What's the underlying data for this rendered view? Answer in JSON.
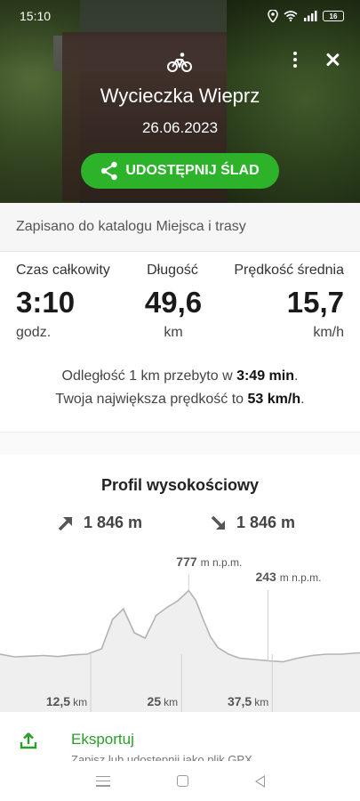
{
  "status_bar": {
    "time": "15:10",
    "battery": "16"
  },
  "header": {
    "title": "Wycieczka Wieprz",
    "date": "26.06.2023",
    "share_label": "UDOSTĘPNIJ ŚLAD"
  },
  "saved_notice": "Zapisano do katalogu Miejsca i trasy",
  "stats": [
    {
      "label": "Czas całkowity",
      "value": "3:10",
      "unit": "godz."
    },
    {
      "label": "Długość",
      "value": "49,6",
      "unit": "km"
    },
    {
      "label": "Prędkość średnia",
      "value": "15,7",
      "unit": "km/h"
    }
  ],
  "facts": {
    "pace_prefix": "Odległość 1 km przebyto w ",
    "pace_value": "3:49 min",
    "pace_suffix": ".",
    "speed_prefix": "Twoja największa prędkość to ",
    "speed_value": "53 km/h",
    "speed_suffix": "."
  },
  "profile": {
    "title": "Profil wysokościowy",
    "ascent": "1 846 m",
    "descent": "1 846 m",
    "max_value": "777",
    "max_unit": "m n.p.m.",
    "min_value": "243",
    "min_unit": "m n.p.m.",
    "ticks": [
      {
        "value": "12,5",
        "unit": "km"
      },
      {
        "value": "25",
        "unit": "km"
      },
      {
        "value": "37,5",
        "unit": "km"
      }
    ]
  },
  "chart_data": {
    "type": "area",
    "title": "Profil wysokościowy",
    "xlabel": "km",
    "ylabel": "m n.p.m.",
    "x": [
      0,
      2,
      4,
      6,
      8,
      10,
      12,
      14,
      15.5,
      17,
      18.5,
      20,
      21.5,
      23,
      24.5,
      26,
      27,
      28,
      29,
      30,
      31.5,
      33,
      35,
      37,
      39,
      41,
      43,
      45,
      47,
      49.6
    ],
    "y": [
      300,
      280,
      285,
      290,
      282,
      295,
      300,
      340,
      560,
      640,
      460,
      420,
      590,
      650,
      700,
      777,
      700,
      560,
      430,
      350,
      300,
      270,
      260,
      250,
      243,
      270,
      290,
      300,
      300,
      310
    ],
    "xticks": [
      12.5,
      25,
      37.5
    ],
    "max": 777,
    "min": 243,
    "xlim": [
      0,
      49.6
    ],
    "ylim": [
      0,
      800
    ]
  },
  "export": {
    "label": "Eksportuj",
    "sub": "Zapisz lub udostępnij jako plik GPX"
  },
  "colors": {
    "accent": "#2db32a",
    "export_text": "#2a9d2a"
  }
}
